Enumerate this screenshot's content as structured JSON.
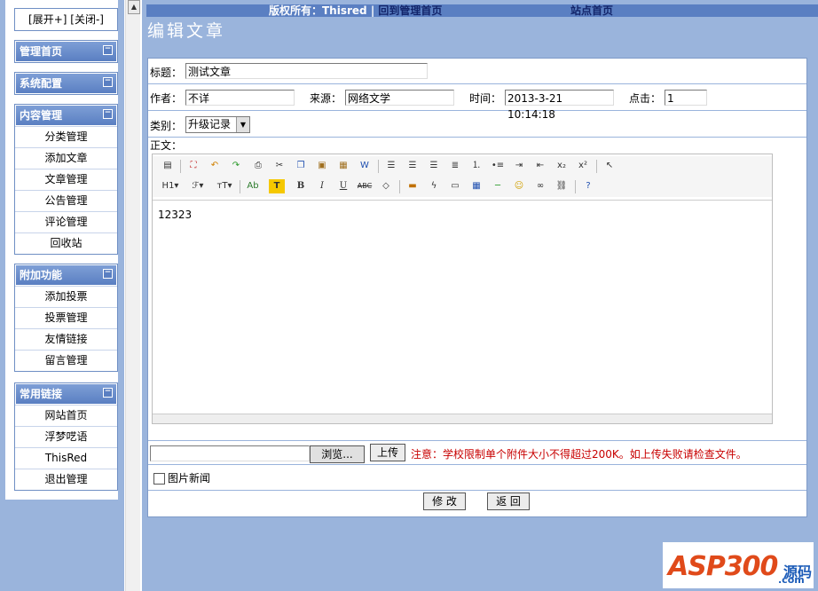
{
  "sidebar": {
    "expand_label": "[展开+]",
    "collapse_label": "[关闭-]",
    "minimize_glyph": "−",
    "menus": [
      {
        "title": "管理首页",
        "items": []
      },
      {
        "title": "系统配置",
        "items": []
      },
      {
        "title": "内容管理",
        "items": [
          "分类管理",
          "添加文章",
          "文章管理",
          "公告管理",
          "评论管理",
          "回收站"
        ]
      },
      {
        "title": "附加功能",
        "items": [
          "添加投票",
          "投票管理",
          "友情链接",
          "留言管理"
        ]
      },
      {
        "title": "常用链接",
        "items": [
          "网站首页",
          "浮梦呓语",
          "ThisRed",
          "退出管理"
        ]
      }
    ]
  },
  "topbar": {
    "copyright": "版权所有：Thisred",
    "separator": "|",
    "admin_home": "回到管理首页",
    "site_home": "站点首页"
  },
  "page_title": "编辑文章",
  "form": {
    "title_label": "标题：",
    "title_value": "测试文章",
    "author_label": "作者：",
    "author_value": "不详",
    "source_label": "来源：",
    "source_value": "网络文学",
    "time_label": "时间：",
    "time_value": "2013-3-21 10:14:18",
    "clicks_label": "点击：",
    "clicks_value": "1",
    "category_label": "类别：",
    "category_value": "升级记录",
    "body_label": "正文：",
    "body_text": "12323",
    "browse_label": "浏览...",
    "upload_label": "上传",
    "upload_notice": "注意：学校限制单个附件大小不得超过200K。如上传失败请检查文件。",
    "picture_news_label": "图片新闻",
    "modify_label": "修 改",
    "back_label": "返 回"
  },
  "toolbar_row1": [
    "source-icon",
    "fullscreen-icon",
    "undo-icon",
    "redo-icon",
    "print-icon",
    "cut-icon",
    "copy-icon",
    "paste-icon",
    "paste-text-icon",
    "paste-word-icon",
    "align-left-icon",
    "align-center-icon",
    "align-right-icon",
    "justify-icon",
    "ordered-list-icon",
    "unordered-list-icon",
    "indent-icon",
    "outdent-icon",
    "subscript-icon",
    "superscript-icon",
    "select-icon"
  ],
  "toolbar_row2": [
    "heading-icon",
    "font-family-icon",
    "font-size-icon",
    "font-color-icon",
    "highlight-icon",
    "bold-icon",
    "italic-icon",
    "underline-icon",
    "strikethrough-icon",
    "clear-format-icon",
    "image-icon",
    "flash-icon",
    "media-icon",
    "table-icon",
    "hr-icon",
    "emoticon-icon",
    "link-icon",
    "unlink-icon",
    "help-icon"
  ],
  "logo": {
    "brand": "ASP300",
    "suffix": "源码",
    "domain": ".com"
  }
}
